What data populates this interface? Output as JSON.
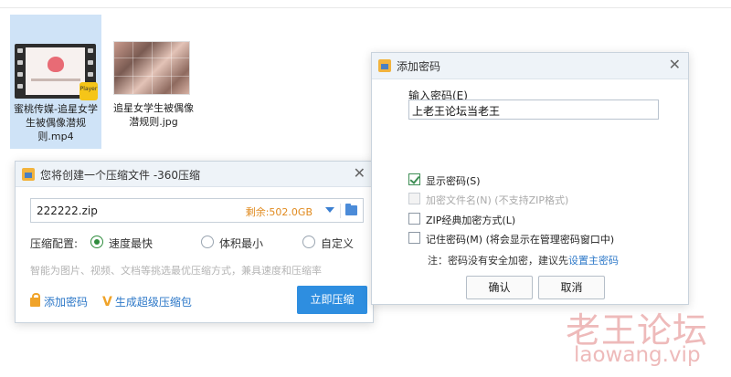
{
  "desktop": {
    "files": [
      {
        "name": "蜜桃传媒-追星女学生被偶像潜规则.mp4",
        "badge": "Player"
      },
      {
        "name": "追星女学生被偶像潜规则.jpg"
      }
    ]
  },
  "compress_dialog": {
    "title": "您将创建一个压缩文件 -360压缩",
    "filename": "222222.zip",
    "free_space": "剩余:502.0GB",
    "config_label": "压缩配置:",
    "options": [
      {
        "label": "速度最快",
        "selected": true
      },
      {
        "label": "体积最小",
        "selected": false
      },
      {
        "label": "自定义",
        "selected": false
      }
    ],
    "hint": "智能为图片、视频、文档等挑选最优压缩方式，兼具速度和压缩率",
    "add_password": "添加密码",
    "super_package": "生成超级压缩包",
    "compress_now": "立即压缩"
  },
  "password_dialog": {
    "title": "添加密码",
    "input_label": "输入密码(E)",
    "password_value": "上老王论坛当老王",
    "checkboxes": [
      {
        "label": "显示密码(S)",
        "checked": true,
        "disabled": false
      },
      {
        "label": "加密文件名(N) (不支持ZIP格式)",
        "checked": false,
        "disabled": true
      },
      {
        "label": "ZIP经典加密方式(L)",
        "checked": false,
        "disabled": false
      },
      {
        "label": "记住密码(M) (将会显示在管理密码窗口中)",
        "checked": false,
        "disabled": false
      }
    ],
    "note_prefix": "注：密码没有安全加密，建议先",
    "note_link": "设置主密码",
    "ok": "确认",
    "cancel": "取消"
  },
  "watermark": {
    "cn": "老王论坛",
    "en": "laowang.vip"
  },
  "colors": {
    "accent": "#2e8ee0",
    "link": "#2d78c8",
    "free_space": "#e08a1e",
    "check": "#3e8e55"
  }
}
